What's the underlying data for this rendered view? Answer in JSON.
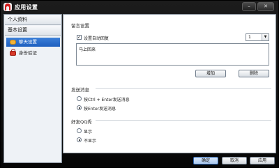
{
  "window": {
    "title": "应用设置",
    "close_label": "✕",
    "minimize_label": "–"
  },
  "sidebar": {
    "groups": [
      {
        "label": "个人资料"
      },
      {
        "label": "基本设置"
      }
    ],
    "items": [
      {
        "label": "聊天设置",
        "icon": "chat-bubble-icon",
        "active": true
      },
      {
        "label": "身份验证",
        "icon": "lock-icon",
        "active": false
      }
    ]
  },
  "auto_reply": {
    "section_title": "留言设置",
    "enable_label": "设置自动回复",
    "enabled": true,
    "selected_index": "1",
    "message": "马上回来",
    "add_label": "增加",
    "delete_label": "删除"
  },
  "send_message": {
    "section_title": "发送消息",
    "options": [
      {
        "label": "按Ctrl + Enter发送消息",
        "selected": false
      },
      {
        "label": "按Enter发送消息",
        "selected": true
      }
    ]
  },
  "friend_show": {
    "section_title": "好友QQ秀",
    "options": [
      {
        "label": "显示",
        "selected": false
      },
      {
        "label": "不显示",
        "selected": true
      }
    ]
  },
  "footer": {
    "ok_label": "确定",
    "cancel_label": "取消",
    "apply_label": "应用"
  }
}
